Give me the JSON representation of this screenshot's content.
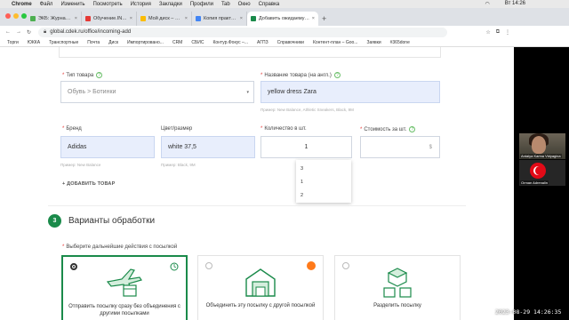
{
  "menubar": {
    "app": "Chrome",
    "items": [
      "Файл",
      "Изменить",
      "Посмотреть",
      "История",
      "Закладки",
      "Профили",
      "Tab",
      "Окно",
      "Справка"
    ],
    "clock": "Вт 14:26"
  },
  "tabs": [
    {
      "title": "ЭКБ: Журнал контрагентов",
      "color": "#4caf50"
    },
    {
      "title": "Обучение.INPSYCHO",
      "color": "#e53935"
    },
    {
      "title": "Мой диск – Google Диск",
      "color": "#fbbc04"
    },
    {
      "title": "Копия практика – Google До...",
      "color": "#4285f4"
    },
    {
      "title": "Добавить ожидаемую посылку",
      "color": "#1a8a4a"
    }
  ],
  "address": {
    "url": "global.cdek.ru/office/incoming-add"
  },
  "bookmarks": [
    "Торги",
    "ЮККА",
    "Транспортные",
    "Почта",
    "Диск",
    "Импортировано...",
    "CRM",
    "СБИС",
    "Контур.Фокус –...",
    "АГПЗ",
    "Справочники",
    "Контент-план – Goo...",
    "Заявки",
    "#365done"
  ],
  "form": {
    "type_label": "Тип товара",
    "type_value": "Обувь > Ботинки",
    "name_label": "Название товара (на англ.)",
    "name_value": "yellow dress Zara",
    "name_hint": "Пример: New Balance, Athletic Sneakers, Black, 9M",
    "brand_label": "Бренд",
    "brand_value": "Adidas",
    "brand_hint": "Пример: New Balance",
    "color_label": "Цвет/размер",
    "color_value": "white 37,5",
    "color_hint": "Пример: Black, 9M",
    "qty_label": "Количество в шт.",
    "qty_value": "1",
    "price_label": "Стоимость за шт.",
    "price_value": "$",
    "qty_options": [
      "3",
      "1",
      "2"
    ],
    "add_product": "+ ДОБАВИТЬ ТОВАР"
  },
  "step": {
    "number": "3",
    "title": "Варианты обработки",
    "prompt": "Выберите дальнейшие действия с посылкой",
    "options": [
      {
        "label": "Отправить посылку сразу без объединения с другими посылками",
        "selected": true
      },
      {
        "label": "Объединить эту посылку с другой посылкой",
        "selected": false
      },
      {
        "label": "Разделить посылку",
        "selected": false
      }
    ]
  },
  "participants": [
    {
      "name": "Antalya Karina Vidyagina"
    },
    {
      "name": "Orman Adrenalin"
    }
  ],
  "timestamp": "2023-08-29 14:26:35",
  "colors": {
    "accent": "#1a8a4a",
    "filled": "#e8eefc",
    "required": "#e53935"
  }
}
